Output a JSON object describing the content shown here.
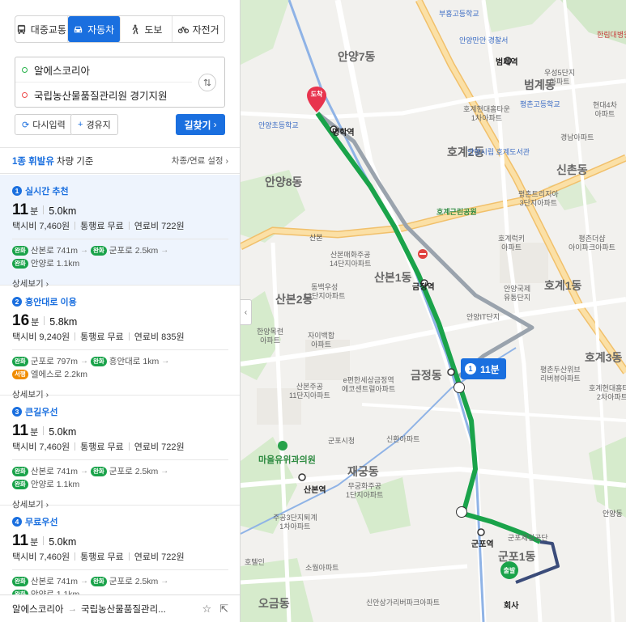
{
  "modes": [
    {
      "label": "대중교통",
      "icon": "bus-icon"
    },
    {
      "label": "자동차",
      "icon": "car-icon",
      "active": true
    },
    {
      "label": "도보",
      "icon": "walk-icon"
    },
    {
      "label": "자전거",
      "icon": "bike-icon"
    }
  ],
  "route_input": {
    "origin": "알에스코리아",
    "destination": "국립농산물품질관리원 경기지원"
  },
  "buttons": {
    "reset": "다시입력",
    "waypoint": "경유지",
    "find": "길찾기"
  },
  "fuel": {
    "type": "1종 휘발유",
    "rest": "차량 기준",
    "settings": "차종/연료 설정"
  },
  "routes": [
    {
      "num": "1",
      "title": "실시간 추천",
      "mins": "11",
      "unit": "분",
      "dist": "5.0km",
      "taxi": "택시비 7,460원",
      "toll": "통행료 무료",
      "fuel": "연료비 722원",
      "roads": [
        [
          {
            "badge": "완화",
            "name": "산본로 741m"
          },
          {
            "badge": "완화",
            "name": "군포로 2.5km"
          }
        ],
        [
          {
            "badge": "완화",
            "name": "안양로 1.1km"
          }
        ]
      ],
      "detail": "상세보기"
    },
    {
      "num": "2",
      "title": "흥안대로 이용",
      "mins": "16",
      "unit": "분",
      "dist": "5.8km",
      "taxi": "택시비 9,240원",
      "toll": "통행료 무료",
      "fuel": "연료비 835원",
      "roads": [
        [
          {
            "badge": "완화",
            "name": "군포로 797m"
          },
          {
            "badge": "완화",
            "name": "흥안대로 1km"
          }
        ],
        [
          {
            "badge": "서행",
            "name": "엘에스로 2.2km",
            "orange": true
          }
        ]
      ],
      "detail": "상세보기"
    },
    {
      "num": "3",
      "title": "큰길우선",
      "mins": "11",
      "unit": "분",
      "dist": "5.0km",
      "taxi": "택시비 7,460원",
      "toll": "통행료 무료",
      "fuel": "연료비 722원",
      "roads": [
        [
          {
            "badge": "완화",
            "name": "산본로 741m"
          },
          {
            "badge": "완화",
            "name": "군포로 2.5km"
          }
        ],
        [
          {
            "badge": "완화",
            "name": "안양로 1.1km"
          }
        ]
      ],
      "detail": "상세보기"
    },
    {
      "num": "4",
      "title": "무료우선",
      "mins": "11",
      "unit": "분",
      "dist": "5.0km",
      "taxi": "택시비 7,460원",
      "toll": "통행료 무료",
      "fuel": "연료비 722원",
      "roads": [
        [
          {
            "badge": "완화",
            "name": "산본로 741m"
          },
          {
            "badge": "완화",
            "name": "군포로 2.5km"
          }
        ],
        [
          {
            "badge": "완화",
            "name": "안양로 1.1km"
          }
        ]
      ],
      "detail": "상세보기"
    }
  ],
  "bottom": {
    "origin": "알에스코리아",
    "arrow": "→",
    "destination": "국립농산물품질관리..."
  },
  "map": {
    "eta_num": "1",
    "eta": "11분",
    "dest_pin": "도착",
    "start_pin": "출발",
    "labels": {
      "anyang7": "안양7동",
      "anyang8": "안양8동",
      "beomgye_dong": "범계동",
      "hogye2": "호계2동",
      "sinchon": "신촌동",
      "hogye1": "호계1동",
      "hogye3": "호계3동",
      "sanbon1": "산본1동",
      "sanbon2": "산본2동",
      "geumjeong": "금정동",
      "jaegung": "재궁동",
      "gunpo1": "군포1동",
      "ogeum": "오금동",
      "beomgye_st": "범계역",
      "myeonghak_st": "명학역",
      "geumjeong_st": "금정역",
      "sanbon_st": "산본역",
      "gunpo_st": "군포역",
      "company": "회사",
      "maeul_hospital": "마을유위과의원",
      "sanbon_ic": "산본",
      "hogye_park": "호계근린공원",
      "anyang_it": "안양IT단지",
      "gunpo_city": "군포시청",
      "gunpo_complex": "군포제일공단",
      "anyang_gukje": "안양국제\n유통단지",
      "bugok": "부흥고등학교",
      "anyang_police": "안양만안 경찰서",
      "beomgye_school": "평촌고등학교",
      "hogye_hyundai": "호계현대홈타운\n1차아파트",
      "anyang_city": "안양시립 호계도서관",
      "sanbon_maehwa": "산본매화주공\n14단지아파트",
      "dongbaek": "동백우성\n13단지아파트",
      "hanyang": "한양목련\n아파트",
      "jayeon": "자이백합\n아파트",
      "sanbon_jugong": "산본주공\n11단지아파트",
      "ecenter": "e편한세상금정역\n에코센트럴아파트",
      "sinhwan": "신환아파트",
      "mugung": "무궁화주공\n1단지아파트",
      "jugong3": "주공3단지퇴계\n1차아파트",
      "soul": "소월아파트",
      "pyeongchon_trillium": "평촌트리지아\n3단지아파트",
      "hogye_ok": "호계럭키\n아파트",
      "pyeongchon_desang": "평촌더샵\n아이파크아파트",
      "hogye_hyundai2": "호계현대홈타운\n2차아파트",
      "pyeongchon_river": "평촌두산위브\n리버뷰아파트",
      "ujeong": "우성5단지\n아파트",
      "hyundai_ie": "현대4차\n아파트",
      "gyeongnam": "경남아파트",
      "sinan": "신안상가리버파크아파트",
      "anyang_jaja": "안양초등학교",
      "anyang_station_apt": "한림대병원",
      "anyang_dong": "안양동",
      "hotel": "호텔인"
    }
  },
  "colors": {
    "accent": "#1a6fdf",
    "route_main": "#1aa34a",
    "route_alt": "#9aa3ad"
  }
}
